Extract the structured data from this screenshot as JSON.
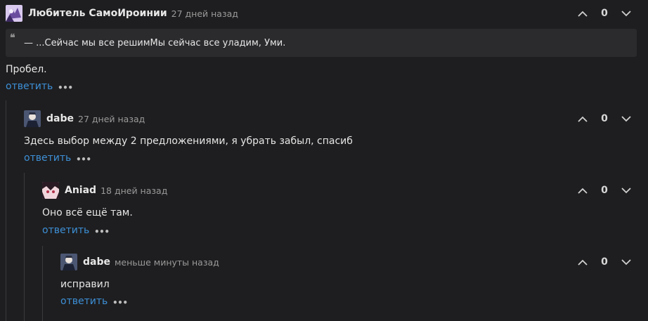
{
  "comments": [
    {
      "author": "Любитель СамоИроинии",
      "time": "27 дней назад",
      "quote": "— ...Сейчас мы все решимМы сейчас все уладим, Уми.",
      "text": "Пробел.",
      "reply_label": "ответить",
      "more_label": "•••",
      "score": "0"
    },
    {
      "author": "dabe",
      "time": "27 дней назад",
      "text": "Здесь выбор между 2 предложениями, я убрать забыл, спасиб",
      "reply_label": "ответить",
      "more_label": "•••",
      "score": "0"
    },
    {
      "author": "Aniad",
      "time": "18 дней назад",
      "text": "Оно всё ещё там.",
      "reply_label": "ответить",
      "more_label": "•••",
      "score": "0"
    },
    {
      "author": "dabe",
      "time": "меньше минуты назад",
      "text": "исправил",
      "reply_label": "ответить",
      "more_label": "•••",
      "score": "0"
    }
  ],
  "icons": {
    "upvote": "chevron-up-icon",
    "downvote": "chevron-down-icon",
    "quote": "quote-icon",
    "more": "more-dots-icon"
  },
  "colors": {
    "background": "#1e1e20",
    "link": "#3d8fd6",
    "quote_bg": "#2b2b2e",
    "thread_line": "#3a3a3d"
  }
}
